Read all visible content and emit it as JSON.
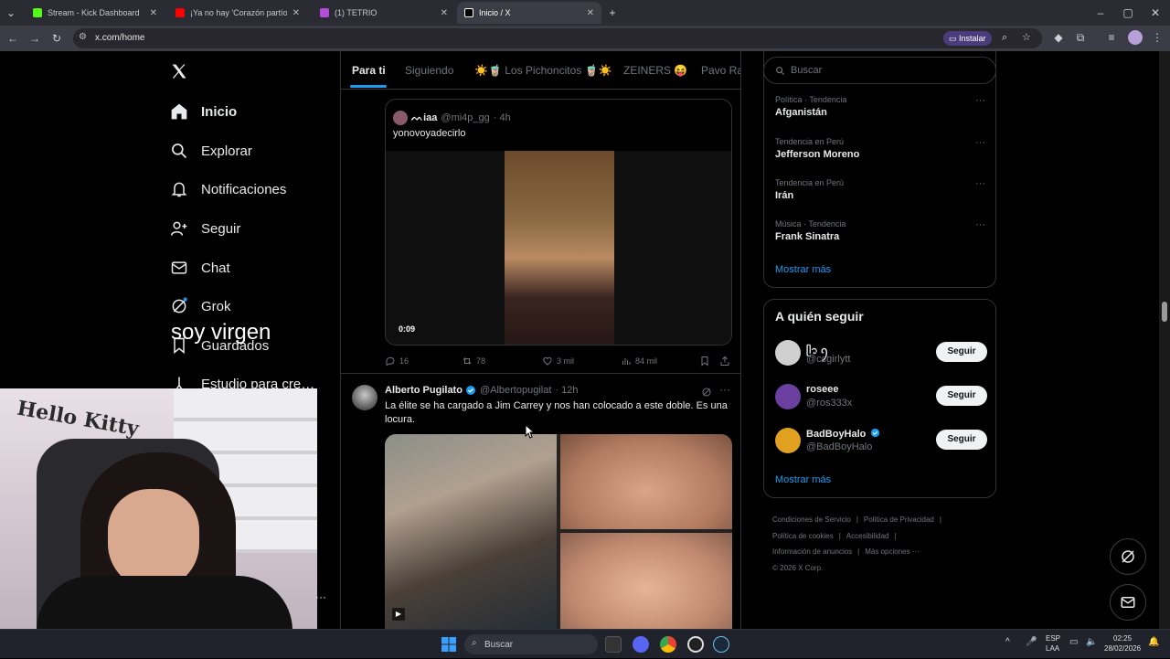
{
  "browser": {
    "tabs": [
      {
        "title": "Stream - Kick Dashboard",
        "favicon_color": "#53fc18"
      },
      {
        "title": "¡Ya no hay 'Corazón partío'! Ale…",
        "favicon_color": "#ff0000"
      },
      {
        "title": "(1) TETRIO",
        "favicon_color": "#b14dd6"
      },
      {
        "title": "Inicio / X",
        "favicon_color": "#ffffff"
      }
    ],
    "url": "x.com/home",
    "install_label": "Instalar"
  },
  "nav": {
    "items": [
      {
        "label": "Inicio",
        "icon": "home-icon"
      },
      {
        "label": "Explorar",
        "icon": "search-icon"
      },
      {
        "label": "Notificaciones",
        "icon": "bell-icon"
      },
      {
        "label": "Seguir",
        "icon": "follow-icon"
      },
      {
        "label": "Chat",
        "icon": "mail-icon"
      },
      {
        "label": "Grok",
        "icon": "grok-icon"
      },
      {
        "label": "Guardados",
        "icon": "bookmark-icon"
      },
      {
        "label": "Estudio para cre…",
        "icon": "studio-icon"
      }
    ],
    "more_label": "···"
  },
  "feed": {
    "tabs": [
      "Para ti",
      "Siguiendo",
      "☀️🧋 Los Pichoncitos 🧋☀️",
      "ZEINERS 😝",
      "Pavo Ra"
    ],
    "quote": {
      "name": "ᨓiaa",
      "handle": "@mi4p_gg",
      "time": "· 4h",
      "text": "yonovoyadecirlo",
      "video_time": "0:09"
    },
    "actions1": {
      "replies": "16",
      "reposts": "78",
      "likes": "3 mil",
      "views": "84 mil"
    },
    "tweet2": {
      "name": "Alberto Pugilato",
      "handle": "@Albertopugilat",
      "time": "· 12h",
      "text": "La élite se ha cargado a Jim Carrey y nos han colocado a este doble. Es una locura."
    }
  },
  "right": {
    "search_placeholder": "Buscar",
    "trends": [
      {
        "meta": "Política · Tendencia",
        "name": "Afganistán"
      },
      {
        "meta": "Tendencia en Perú",
        "name": "Jefferson Moreno"
      },
      {
        "meta": "Tendencia en Perú",
        "name": "Irán"
      },
      {
        "meta": "Música · Tendencia",
        "name": "Frank Sinatra"
      }
    ],
    "show_more": "Mostrar más",
    "who_to_follow_title": "A quién seguir",
    "follow": [
      {
        "name": "ᥫ᭡ ꪆ",
        "handle": "@ccgirlytt",
        "button": "Seguir",
        "avatar_color": "#cfcfcf"
      },
      {
        "name": "roseee",
        "handle": "@ros333x",
        "button": "Seguir",
        "avatar_color": "#6a3fa0"
      },
      {
        "name": "BadBoyHalo",
        "handle": "@BadBoyHalo",
        "button": "Seguir",
        "avatar_color": "#e0a020"
      }
    ],
    "show_more_2": "Mostrar más",
    "footer": {
      "l1a": "Condiciones de Servicio",
      "l1b": "Política de Privacidad",
      "l2a": "Política de cookies",
      "l2b": "Accesibilidad",
      "l3a": "Información de anuncios",
      "l3b": "Más opciones ···",
      "copyright": "© 2026 X Corp."
    }
  },
  "overlay": {
    "text": "soy virgen",
    "sign": "Hello Kitty"
  },
  "taskbar": {
    "search": "Buscar",
    "lang1": "ESP",
    "lang2": "LAA",
    "time": "02:25",
    "date": "28/02/2026"
  }
}
